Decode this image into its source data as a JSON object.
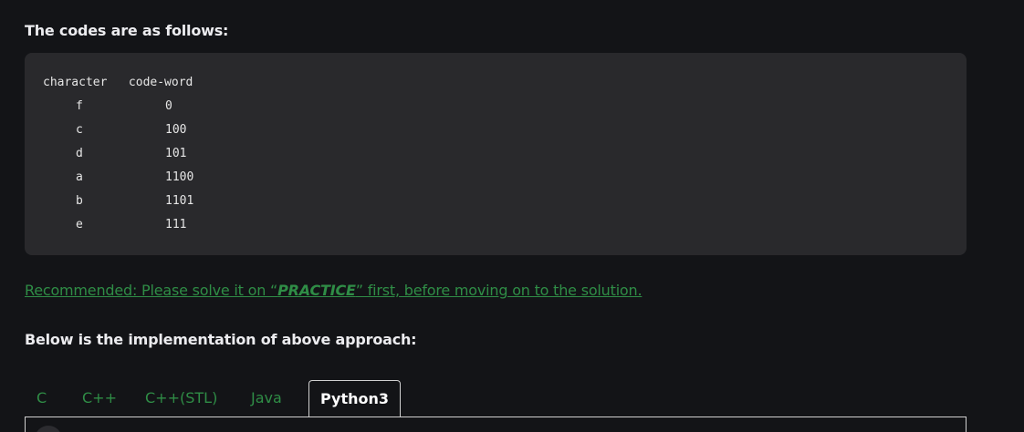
{
  "intro": "The codes are as follows:",
  "code_table": {
    "header": "character   code-word",
    "rows": [
      {
        "character": "f",
        "code_word": "0"
      },
      {
        "character": "c",
        "code_word": "100"
      },
      {
        "character": "d",
        "code_word": "101"
      },
      {
        "character": "a",
        "code_word": "1100"
      },
      {
        "character": "b",
        "code_word": "1101"
      },
      {
        "character": "e",
        "code_word": "111"
      }
    ]
  },
  "recommended": {
    "prefix": "Recommended: Please solve it on “",
    "emphasis": "PRACTICE",
    "suffix": "” first, before moving on to the solution.",
    "color": "#2f8d46"
  },
  "implementation_heading": "Below is the implementation of above approach:",
  "tabs": [
    {
      "label": "C",
      "active": false
    },
    {
      "label": "C++",
      "active": false
    },
    {
      "label": "C++(STL)",
      "active": false
    },
    {
      "label": "Java",
      "active": false
    },
    {
      "label": "Python3",
      "active": true
    }
  ],
  "colors": {
    "background": "#131417",
    "code_background": "#29292c",
    "accent": "#2f8d46"
  }
}
